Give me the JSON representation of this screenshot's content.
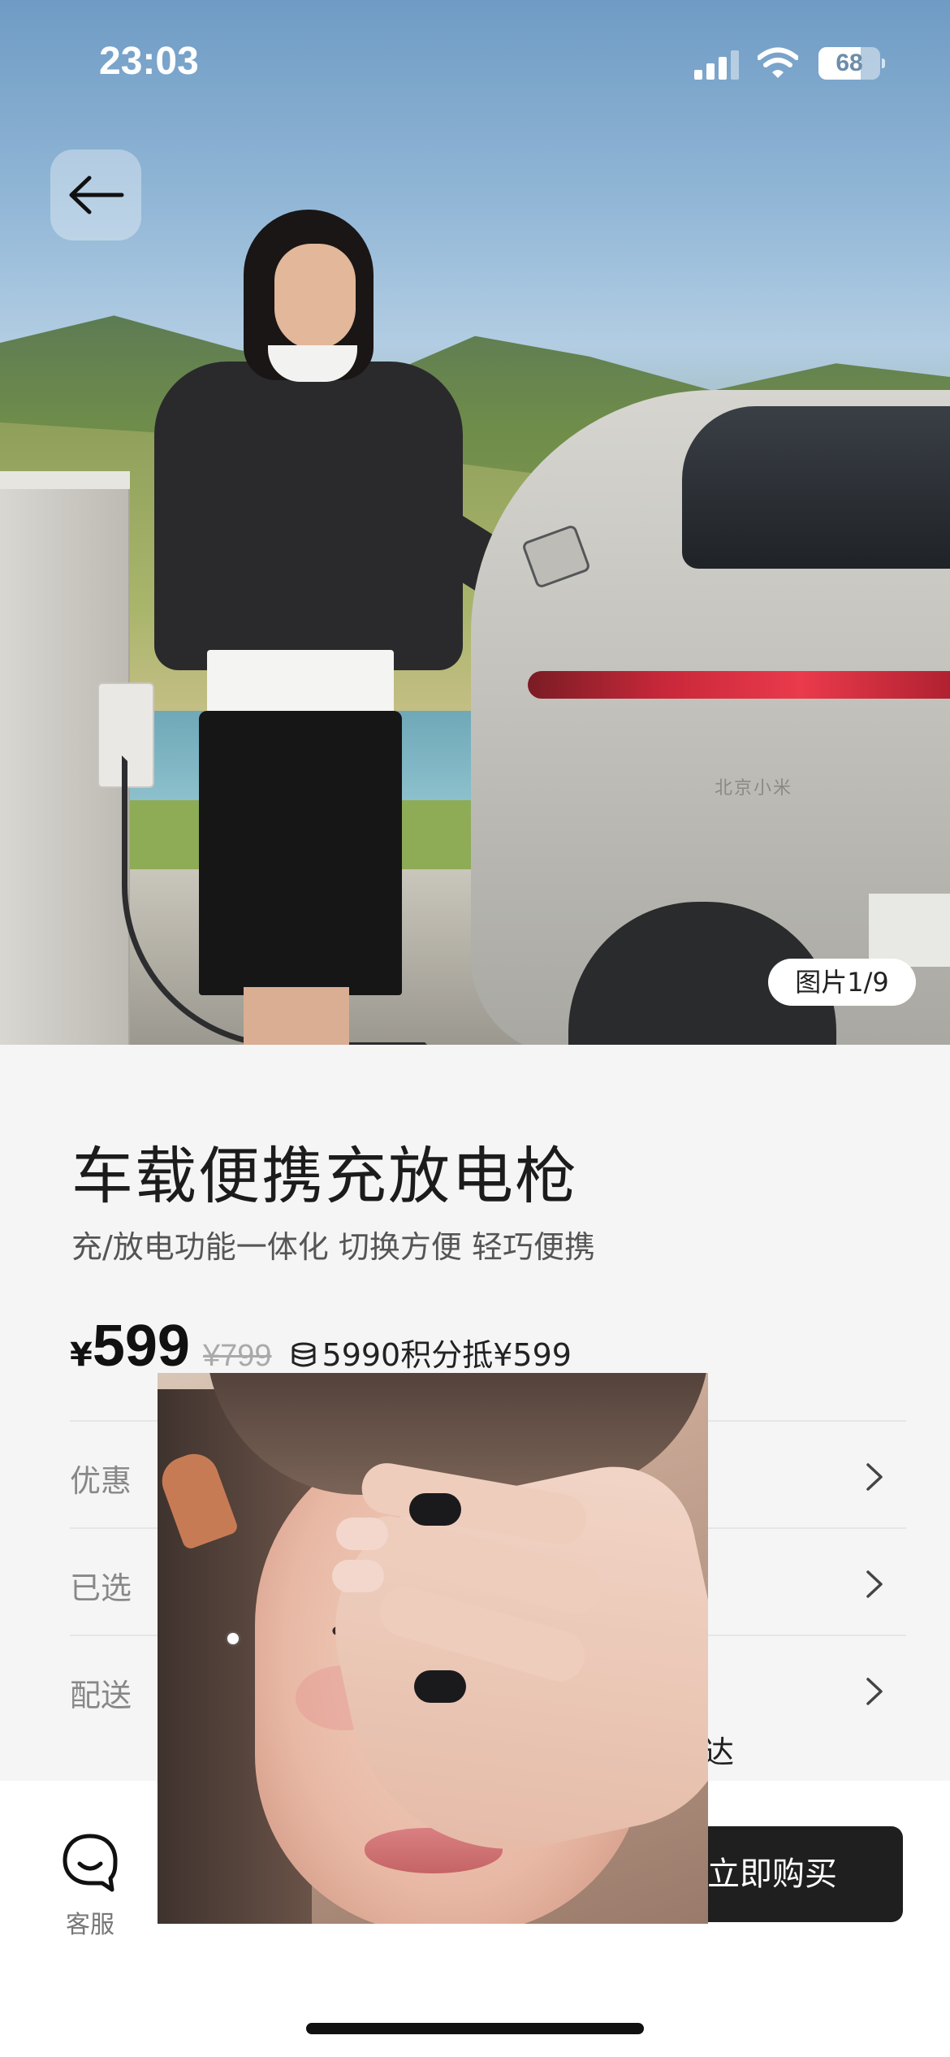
{
  "status_bar": {
    "time": "23:03",
    "battery": "68",
    "battery_level": 0.68,
    "icons": [
      "signal-icon",
      "wifi-icon",
      "battery-icon"
    ]
  },
  "hero": {
    "car_badge": "北京小米",
    "image_counter": "图片1/9"
  },
  "product": {
    "title": "车载便携充放电枪",
    "subtitle": "充/放电功能一体化 切换方便 轻巧便携",
    "price_currency": "¥",
    "price": "599",
    "original_price": "¥799",
    "points_text": "5990积分抵¥599"
  },
  "rows": [
    {
      "label": "优惠",
      "icon": "chevron-right-icon"
    },
    {
      "label": "已选",
      "icon": "chevron-right-icon"
    },
    {
      "label": "配送",
      "icon": "chevron-right-icon",
      "value_tail": "达"
    }
  ],
  "bottom_bar": {
    "service_label": "客服",
    "buy_label": "立即购买"
  },
  "colors": {
    "buy_button": "#1f1f1f",
    "page_background": "#f5f5f5",
    "title_text": "#1c1c1c",
    "muted_text": "#888888"
  }
}
